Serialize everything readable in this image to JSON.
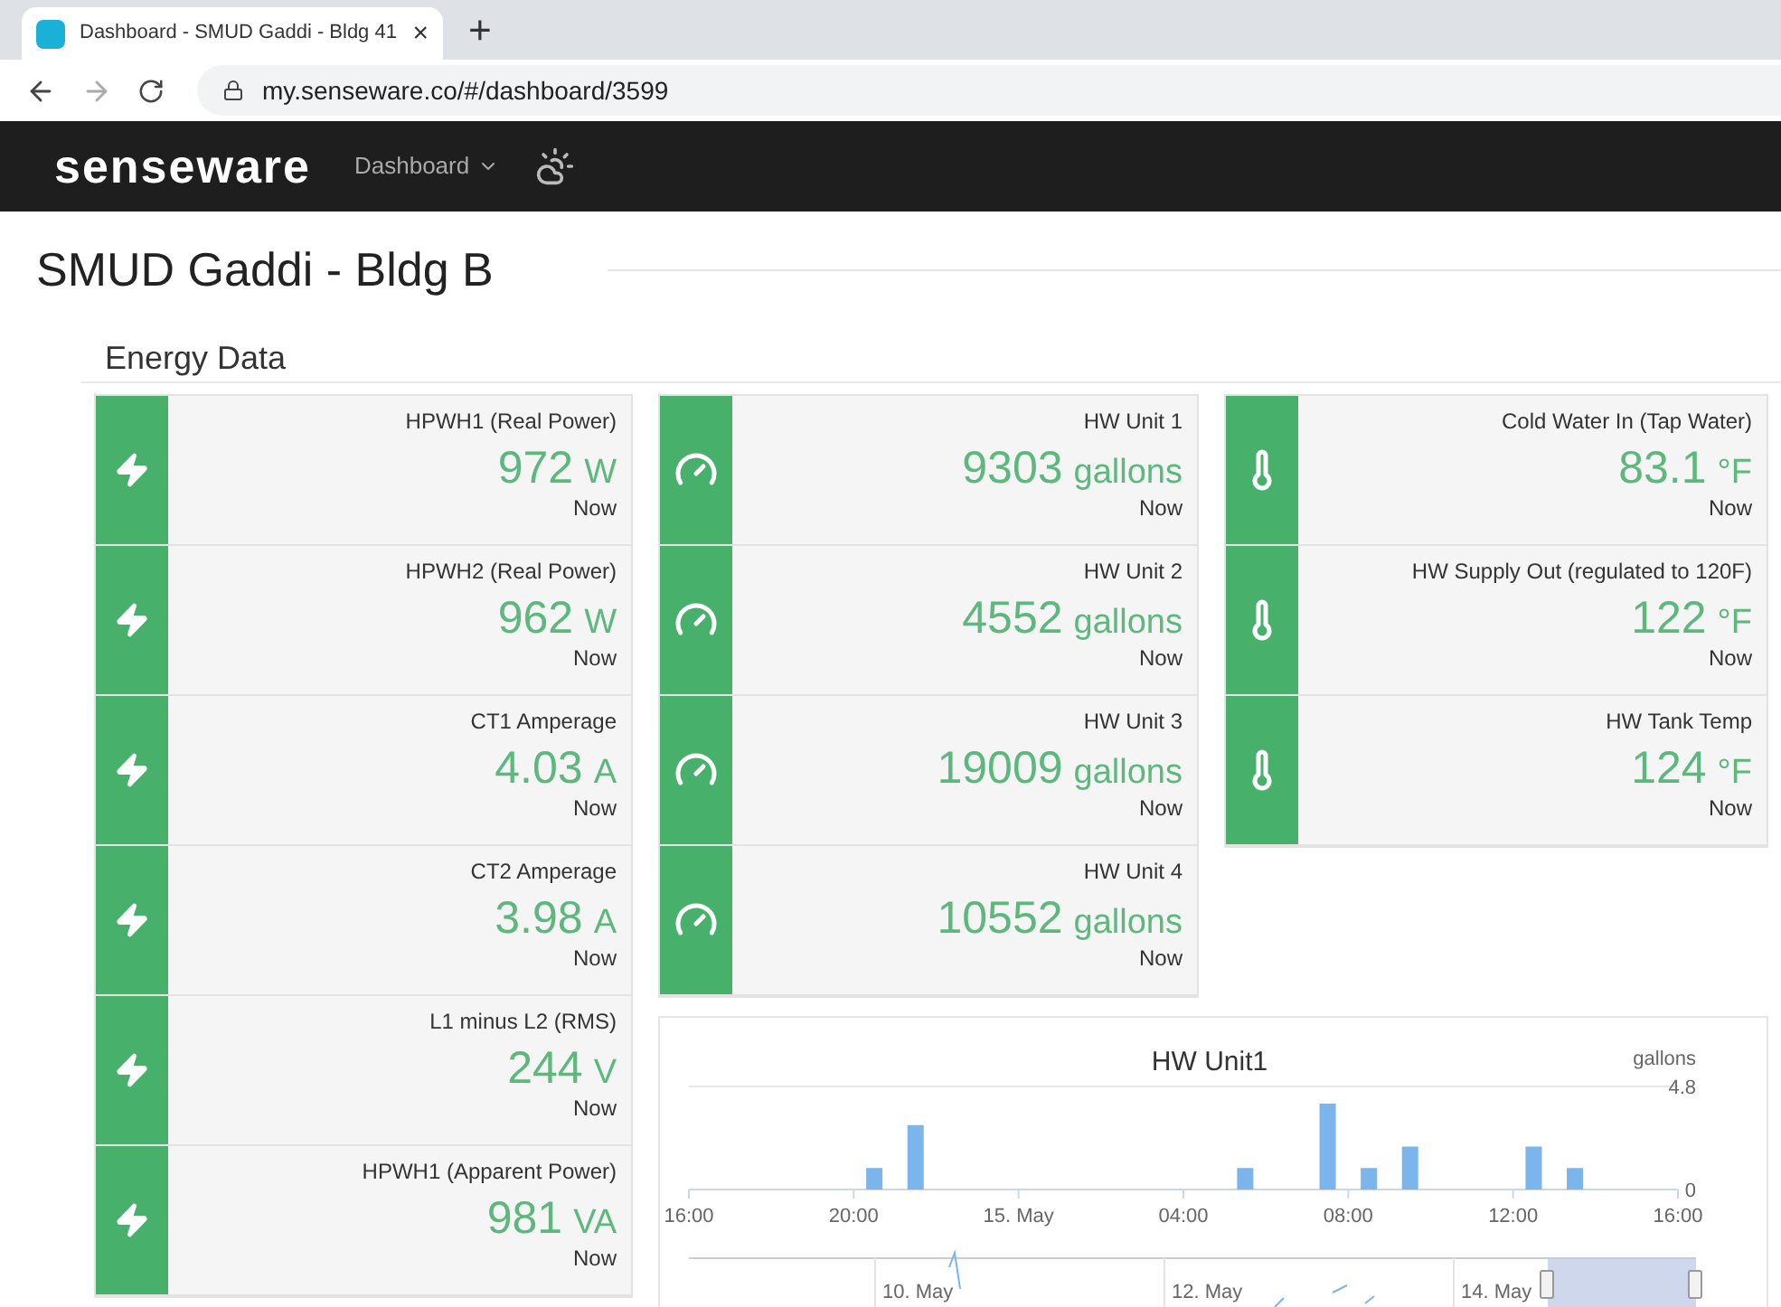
{
  "browser": {
    "tab": {
      "title": "Dashboard - SMUD Gaddi - Bldg 41",
      "close": "×",
      "selected": true
    },
    "new_tab": "+",
    "url": "my.senseware.co/#/dashboard/3599"
  },
  "navbar": {
    "logo": "senseware",
    "menu": "Dashboard"
  },
  "page_title": "SMUD Gaddi - Bldg B",
  "section_title": "Energy Data",
  "columns": [
    [
      {
        "kind": "power",
        "label": "HPWH1 (Real Power)",
        "value": "972",
        "unit": "W",
        "time": "Now"
      },
      {
        "kind": "power",
        "label": "HPWH2 (Real Power)",
        "value": "962",
        "unit": "W",
        "time": "Now"
      },
      {
        "kind": "power",
        "label": "CT1 Amperage",
        "value": "4.03",
        "unit": "A",
        "time": "Now"
      },
      {
        "kind": "power",
        "label": "CT2 Amperage",
        "value": "3.98",
        "unit": "A",
        "time": "Now"
      },
      {
        "kind": "power",
        "label": "L1 minus L2 (RMS)",
        "value": "244",
        "unit": "V",
        "time": "Now"
      },
      {
        "kind": "power",
        "label": "HPWH1 (Apparent Power)",
        "value": "981",
        "unit": "VA",
        "time": "Now"
      }
    ],
    [
      {
        "kind": "flow",
        "label": "HW Unit 1",
        "value": "9303",
        "unit": "gallons",
        "time": "Now"
      },
      {
        "kind": "flow",
        "label": "HW Unit 2",
        "value": "4552",
        "unit": "gallons",
        "time": "Now"
      },
      {
        "kind": "flow",
        "label": "HW Unit 3",
        "value": "19009",
        "unit": "gallons",
        "time": "Now"
      },
      {
        "kind": "flow",
        "label": "HW Unit 4",
        "value": "10552",
        "unit": "gallons",
        "time": "Now"
      }
    ],
    [
      {
        "kind": "temperature",
        "label": "Cold Water In (Tap Water)",
        "value": "83.1",
        "unit": "°F",
        "time": "Now"
      },
      {
        "kind": "temperature",
        "label": "HW Supply Out (regulated to 120F)",
        "value": "122",
        "unit": "°F",
        "time": "Now"
      },
      {
        "kind": "temperature",
        "label": "HW Tank Temp",
        "value": "124",
        "unit": "°F",
        "time": "Now"
      }
    ]
  ],
  "chart": {
    "chart_data": {
      "type": "bar",
      "title": "HW Unit1",
      "ylabel": "gallons",
      "categories": [
        "16:00",
        null,
        null,
        null,
        "20:00",
        null,
        null,
        null,
        "15. May",
        null,
        null,
        null,
        "04:00",
        null,
        null,
        null,
        "08:00",
        null,
        null,
        null,
        "12:00",
        null,
        null,
        null,
        "16:00"
      ],
      "series": [
        {
          "color": "#7cb5ec",
          "values": [
            null,
            null,
            null,
            null,
            1,
            3,
            null,
            null,
            null,
            null,
            null,
            null,
            null,
            1,
            null,
            4,
            1,
            2,
            null,
            null,
            2,
            1,
            null,
            null,
            null
          ]
        }
      ],
      "ylim": [
        0,
        4.8
      ],
      "yticks": [
        {
          "value": 0,
          "label": "0"
        },
        {
          "value": 4.8,
          "label": "4.8"
        }
      ]
    },
    "navigator_labels": [
      "10. May",
      "12. May",
      "14. May"
    ]
  }
}
